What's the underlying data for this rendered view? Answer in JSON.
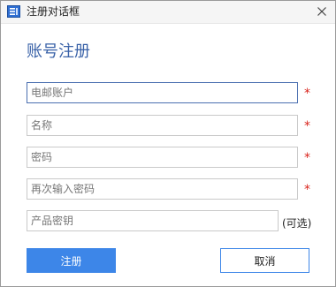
{
  "window": {
    "title": "注册对话框",
    "icon": "app-icon"
  },
  "heading": "账号注册",
  "fields": [
    {
      "placeholder": "电邮账户",
      "value": "",
      "required": true
    },
    {
      "placeholder": "名称",
      "value": "",
      "required": true
    },
    {
      "placeholder": "密码",
      "value": "",
      "required": true
    },
    {
      "placeholder": "再次输入密码",
      "value": "",
      "required": true
    },
    {
      "placeholder": "产品密钥",
      "value": "",
      "required": false
    }
  ],
  "required_mark": "*",
  "optional_label": "(可选)",
  "buttons": {
    "register": "注册",
    "cancel": "取消"
  },
  "colors": {
    "accent": "#3d86e8",
    "heading": "#3a62a8",
    "required": "#d9241c"
  }
}
